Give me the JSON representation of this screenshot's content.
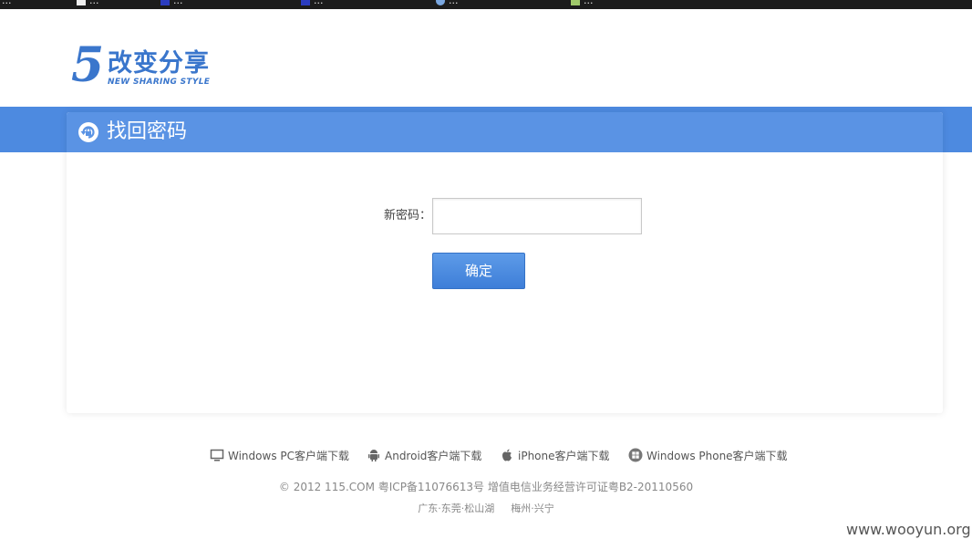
{
  "bookmarks": [
    {
      "label": "...",
      "icon": "page-icon"
    },
    {
      "label": "...",
      "icon": "page-icon"
    },
    {
      "label": "...",
      "icon": "page-icon"
    },
    {
      "label": "...",
      "icon": "page-icon"
    },
    {
      "label": "...",
      "icon": "globe-icon"
    },
    {
      "label": "...",
      "icon": "image-icon"
    }
  ],
  "logo": {
    "mark": "5",
    "text_cn": "改变分享",
    "text_en": "NEW SHARING STYLE"
  },
  "header": {
    "icon": "lock-refresh-icon",
    "title": "找回密码"
  },
  "form": {
    "password_label": "新密码：",
    "password_value": "",
    "confirm_label": "确定"
  },
  "footer": {
    "downloads": [
      {
        "label": "Windows PC客户端下载",
        "icon": "monitor-icon"
      },
      {
        "label": "Android客户端下载",
        "icon": "android-icon"
      },
      {
        "label": "iPhone客户端下载",
        "icon": "apple-icon"
      },
      {
        "label": "Windows Phone客户端下载",
        "icon": "windows-phone-icon"
      }
    ],
    "copyright": "© 2012 115.COM 粤ICP备11076613号 增值电信业务经营许可证粤B2-20110560",
    "locations": [
      "广东·东莞·松山湖",
      "梅州·兴宁"
    ]
  },
  "watermark": "www.wooyun.org",
  "colors": {
    "brand_blue": "#3a76cc",
    "header_blue": "#5a93e4",
    "button_blue": "#4a8ae0"
  }
}
